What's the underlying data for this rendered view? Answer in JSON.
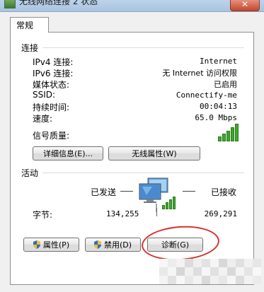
{
  "window": {
    "title": "无线网络连接 2 状态",
    "close_label": "✕"
  },
  "tabs": [
    {
      "label": "常规"
    }
  ],
  "connection": {
    "section_label": "连接",
    "rows": [
      {
        "label": "IPv4 连接:",
        "value": "Internet"
      },
      {
        "label": "IPv6 连接:",
        "value": "无 Internet 访问权限"
      },
      {
        "label": "媒体状态:",
        "value": "已启用"
      },
      {
        "label": "SSID:",
        "value": "Connectify-me"
      },
      {
        "label": "持续时间:",
        "value": "00:04:13"
      },
      {
        "label": "速度:",
        "value": "65.0 Mbps"
      }
    ],
    "signal_label": "信号质量:",
    "signal_bars": 5,
    "details_button": "详细信息(E)...",
    "wireless_props_button": "无线属性(W)"
  },
  "activity": {
    "section_label": "活动",
    "sent_label": "已发送",
    "received_label": "已接收",
    "bytes_label": "字节:",
    "bytes_sent": "134,255",
    "bytes_received": "269,291"
  },
  "buttons": {
    "properties": "属性(P)",
    "disable": "禁用(D)",
    "diagnose": "诊断(G)"
  },
  "colors": {
    "accent_green": "#3ea82d",
    "annotation_red": "#d9302a"
  }
}
